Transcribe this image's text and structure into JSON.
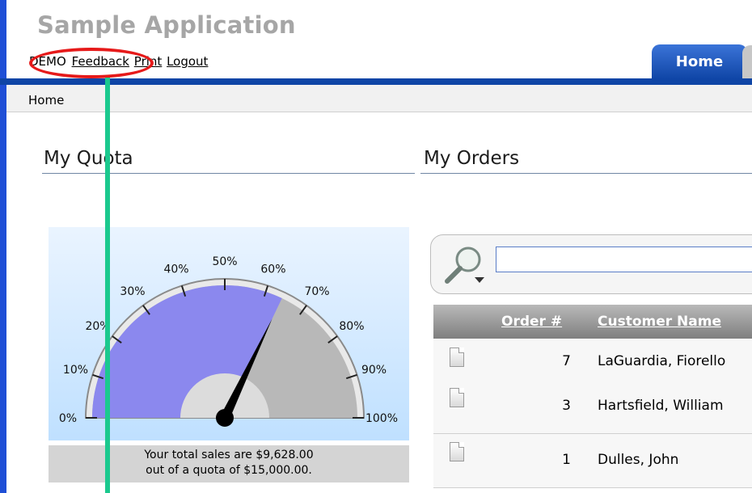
{
  "app": {
    "title": "Sample Application"
  },
  "top_links": {
    "user": "DEMO",
    "feedback": "Feedback",
    "print": "Print",
    "logout": "Logout"
  },
  "tabs": [
    {
      "label": "Home",
      "active": true
    }
  ],
  "breadcrumb": "Home",
  "quota": {
    "title": "My Quota",
    "gauge": {
      "ticks": [
        "0%",
        "10%",
        "20%",
        "30%",
        "40%",
        "50%",
        "60%",
        "70%",
        "80%",
        "90%",
        "100%"
      ],
      "fraction": 0.6419
    },
    "caption_line1": "Your total sales are $9,628.00",
    "caption_line2": "out of a quota of $15,000.00."
  },
  "orders": {
    "title": "My Orders",
    "search_value": "",
    "columns": [
      "Order #",
      "Customer Name"
    ],
    "rows": [
      {
        "order": "7",
        "customer": "LaGuardia, Fiorello"
      },
      {
        "order": "3",
        "customer": "Hartsfield, William"
      },
      {
        "order": "1",
        "customer": "Dulles, John"
      }
    ]
  },
  "colors": {
    "accent": "#0f45a6",
    "gauge_fill": "#8b88ee",
    "highlight": "#e61a1a",
    "pointer_line": "#1bc98e"
  }
}
